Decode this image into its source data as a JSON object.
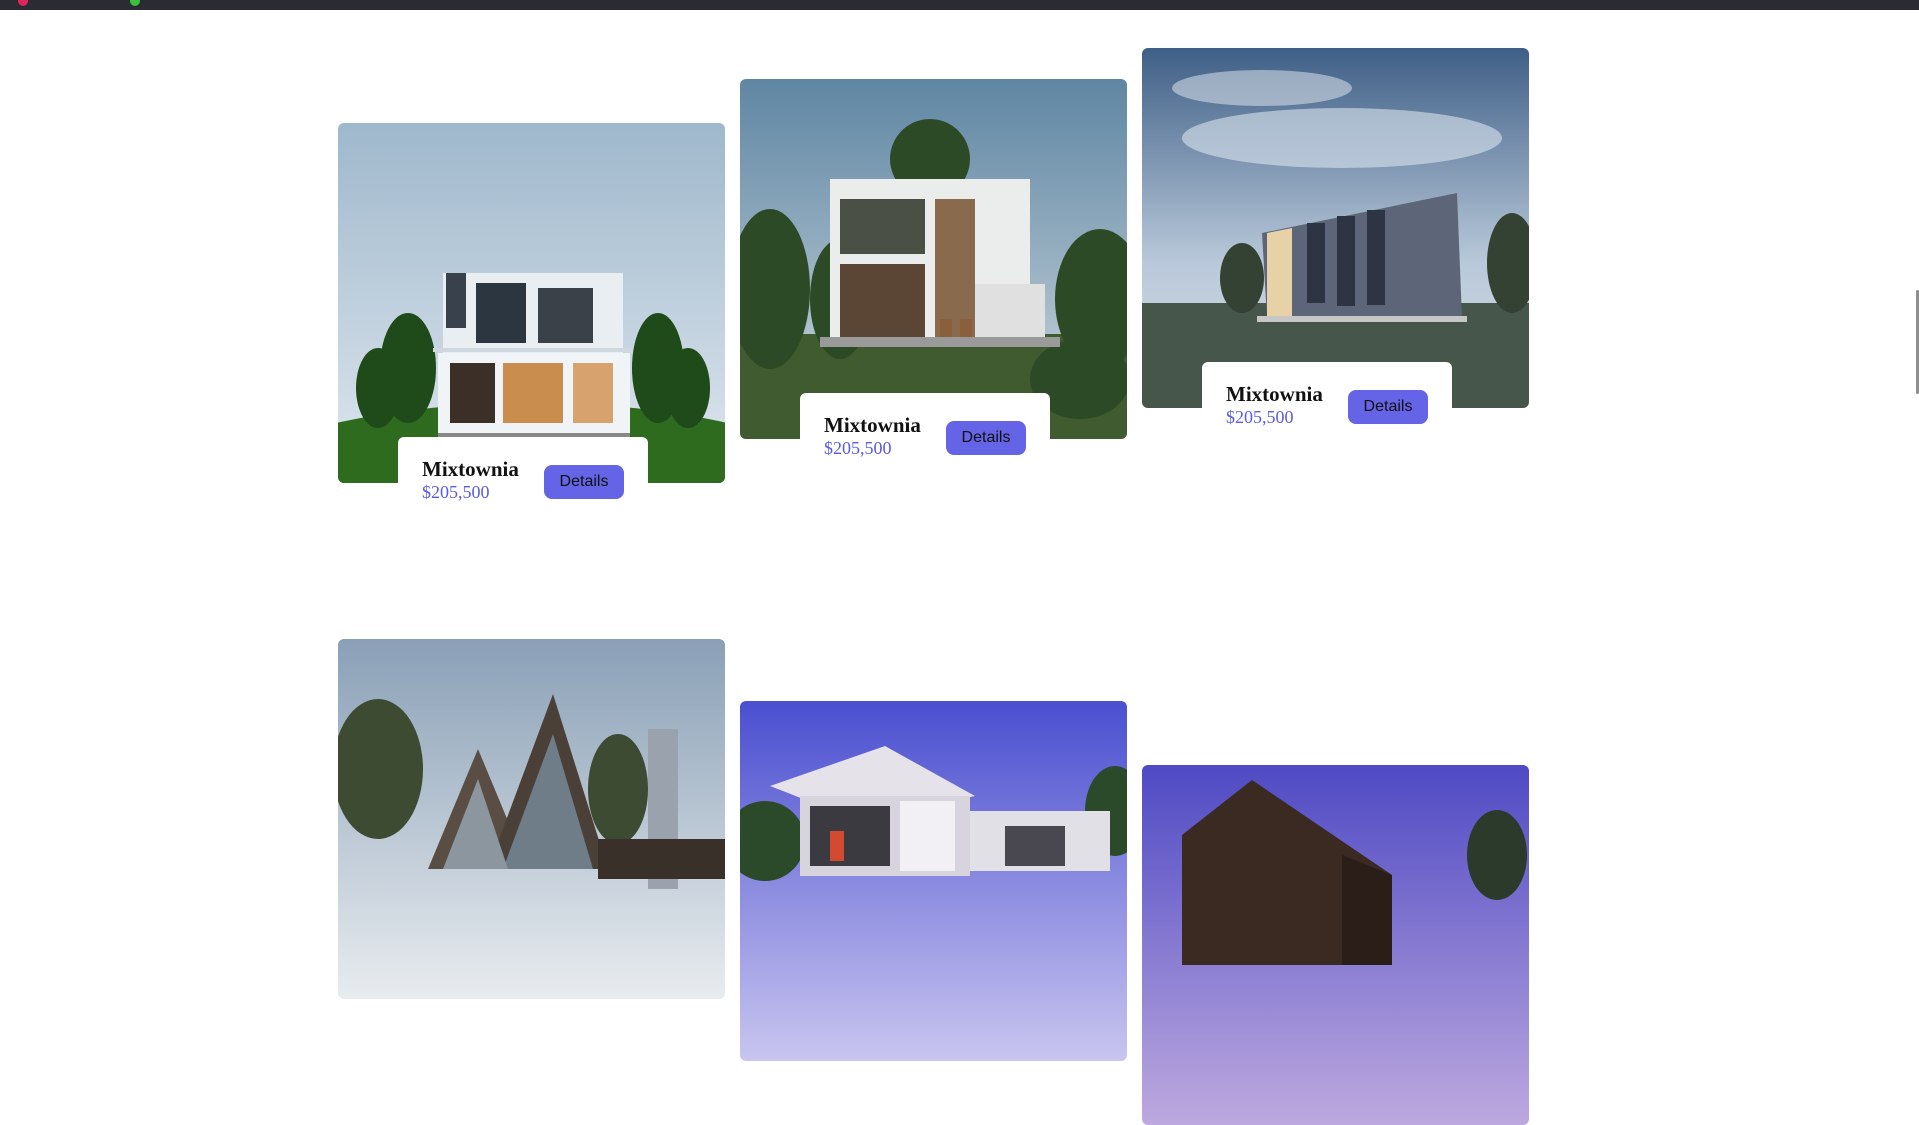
{
  "colors": {
    "accent": "#6563e6",
    "price": "#5b5ce2",
    "topbar": "#2b2b33"
  },
  "listings": [
    {
      "name": "Mixtownia",
      "price": "$205,500",
      "button": "Details",
      "image": "modern-two-story-house-lawn"
    },
    {
      "name": "Mixtownia",
      "price": "$205,500",
      "button": "Details",
      "image": "white-wood-house-forest"
    },
    {
      "name": "Mixtownia",
      "price": "$205,500",
      "button": "Details",
      "image": "angular-gray-house-field"
    },
    {
      "name": "",
      "price": "",
      "button": "",
      "image": "gabled-glass-house-city"
    },
    {
      "name": "",
      "price": "",
      "button": "",
      "image": "cantilever-house-dusk"
    },
    {
      "name": "",
      "price": "",
      "button": "",
      "image": "dark-wood-house-dusk"
    }
  ]
}
